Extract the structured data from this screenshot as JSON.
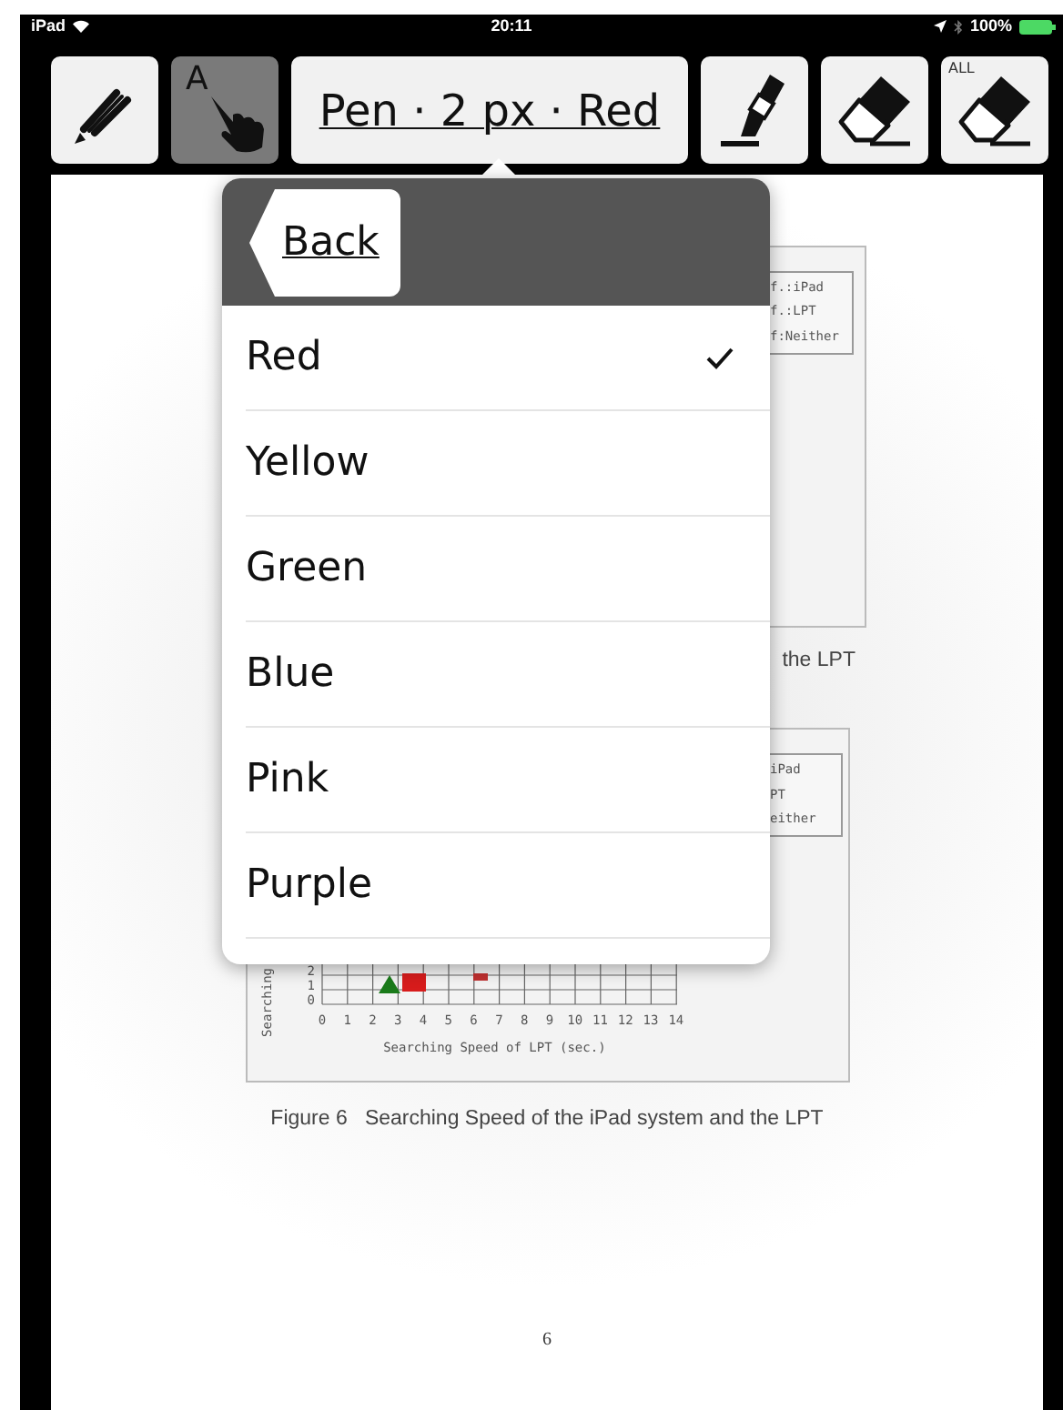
{
  "status_bar": {
    "carrier": "iPad",
    "time": "20:11",
    "battery": "100%"
  },
  "toolbar": {
    "tools": [
      {
        "kind": "pencil",
        "selected": false
      },
      {
        "kind": "touch",
        "selected": true,
        "glyph": "A"
      },
      {
        "kind": "label",
        "selected": false,
        "text": "Pen · 2 px · Red"
      },
      {
        "kind": "marker",
        "selected": false
      },
      {
        "kind": "eraser",
        "selected": false
      },
      {
        "kind": "eraser_all",
        "selected": false,
        "text": "ALL"
      }
    ]
  },
  "popover": {
    "back": "Back",
    "items": [
      {
        "label": "Red",
        "selected": true
      },
      {
        "label": "Yellow",
        "selected": false
      },
      {
        "label": "Green",
        "selected": false
      },
      {
        "label": "Blue",
        "selected": false
      },
      {
        "label": "Pink",
        "selected": false
      },
      {
        "label": "Purple",
        "selected": false
      }
    ]
  },
  "document": {
    "figure_upper": {
      "legend": [
        "f.:iPad",
        "f.:LPT",
        "f:Neither"
      ],
      "caption": "the LPT"
    },
    "figure_lower": {
      "legend": [
        "iPad",
        "PT",
        "either"
      ],
      "ylabel": "Searching",
      "yticks": [
        "2",
        "1",
        "0"
      ],
      "xticks": [
        "0",
        "1",
        "2",
        "3",
        "4",
        "5",
        "6",
        "7",
        "8",
        "9",
        "10",
        "11",
        "12",
        "13",
        "14"
      ],
      "xlabel": "Searching Speed of LPT (sec.)",
      "caption": "Figure 6   Searching Speed of the iPad system and the LPT"
    },
    "page_number": "6"
  }
}
